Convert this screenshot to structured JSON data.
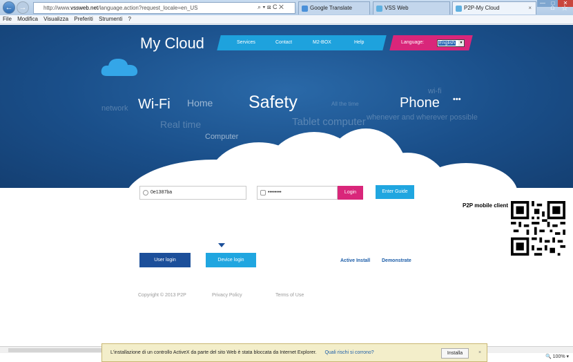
{
  "browser": {
    "url_prefix": "http://www.",
    "url_domain": "vssweb.net",
    "url_path": "/language.action?request_locale=en_US",
    "addr_controls": "⌕ ▾ ⊠ C ✕",
    "tabs": [
      {
        "label": "Google Translate"
      },
      {
        "label": "VSS Web"
      },
      {
        "label": "P2P-My Cloud"
      }
    ],
    "active_tab_close": "×",
    "menu": [
      "File",
      "Modifica",
      "Visualizza",
      "Preferiti",
      "Strumenti",
      "?"
    ],
    "zoom": "🔍 100% ▾"
  },
  "site": {
    "brand": "My Cloud",
    "nav": [
      "Services",
      "Contact",
      "M2-BOX",
      "Help"
    ],
    "language_label": "Language:",
    "language_value": "English",
    "words": {
      "network": "network",
      "wifi": "Wi-Fi",
      "home": "Home",
      "safety": "Safety",
      "all_the_time": "All the time",
      "phone": "Phone",
      "wifi_small": "wi-fi",
      "dots": "•••",
      "real_time": "Real time",
      "tablet_computer": "Tablet computer",
      "whenever": "whenever and wherever possible",
      "computer": "Computer"
    }
  },
  "login": {
    "username_value": "0e1387ba",
    "password_value": "••••••••",
    "login_button": "Login",
    "enter_guide": "Enter Guide",
    "user_login": "User login",
    "device_login": "Device login",
    "active_install": "Active Install",
    "demonstrate": "Demonstrate",
    "p2p_label": "P2P mobile client"
  },
  "footer": {
    "copyright": "Copyright © 2013 P2P",
    "privacy": "Privacy Policy",
    "terms": "Terms of Use"
  },
  "notification": {
    "message": "L'installazione di un controllo ActiveX da parte del sito Web è stata bloccata da Internet Explorer.",
    "risk_link": "Quali rischi si corrono?",
    "install_button": "Installa",
    "close": "×"
  },
  "colors": {
    "banner": "#1a4f8a",
    "nav_blue": "#1ea2dd",
    "lang_pink": "#d9267a",
    "login_pink": "#d9267a",
    "button_cyan": "#20a6e0",
    "user_login_navy": "#1c4f9a"
  }
}
